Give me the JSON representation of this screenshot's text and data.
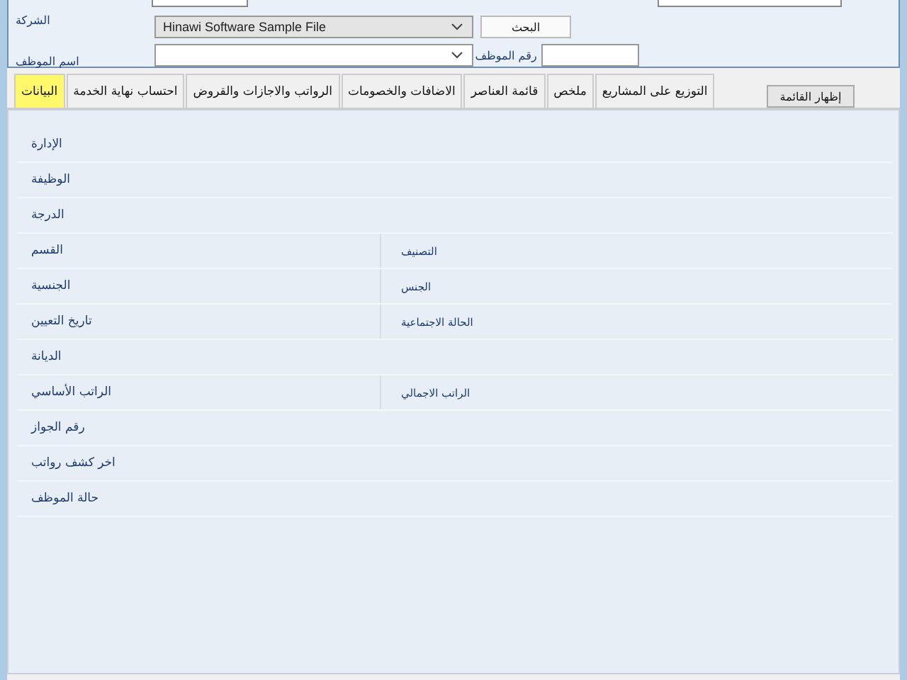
{
  "filter_panel": {
    "company_label": "الشركة",
    "company_value": "Hinawi Software Sample File",
    "search_button": "البحث",
    "employee_name_label": "اسم الموظف",
    "employee_number_label": "رقم الموظف"
  },
  "tabs": [
    {
      "label": "التوزيع على المشاريع",
      "selected": false
    },
    {
      "label": "ملخص",
      "selected": false
    },
    {
      "label": "قائمة العناصر",
      "selected": false
    },
    {
      "label": "الاضافات والخصومات",
      "selected": false
    },
    {
      "label": "الرواتب والاجازات والقروض",
      "selected": false
    },
    {
      "label": "احتساب نهاية الخدمة",
      "selected": false
    },
    {
      "label": "البيانات",
      "selected": true
    }
  ],
  "show_list_button": "إظهار القائمة",
  "fields": [
    {
      "label": "الإدارة"
    },
    {
      "label": "الوظيفة"
    },
    {
      "label": "الدرجة"
    },
    {
      "label": "القسم",
      "label_2": "التصنيف"
    },
    {
      "label": "الجنسية",
      "label_2": "الجنس"
    },
    {
      "label": "تاريخ التعيين",
      "label_2": "الحالة الاجتماعية"
    },
    {
      "label": "الديانة"
    },
    {
      "label": "الراتب الأساسي",
      "label_2": "الراتب الاجمالي"
    },
    {
      "label": "رقم الجواز"
    },
    {
      "label": "اخر كشف رواتب"
    },
    {
      "label": "حالة الموظف"
    }
  ]
}
